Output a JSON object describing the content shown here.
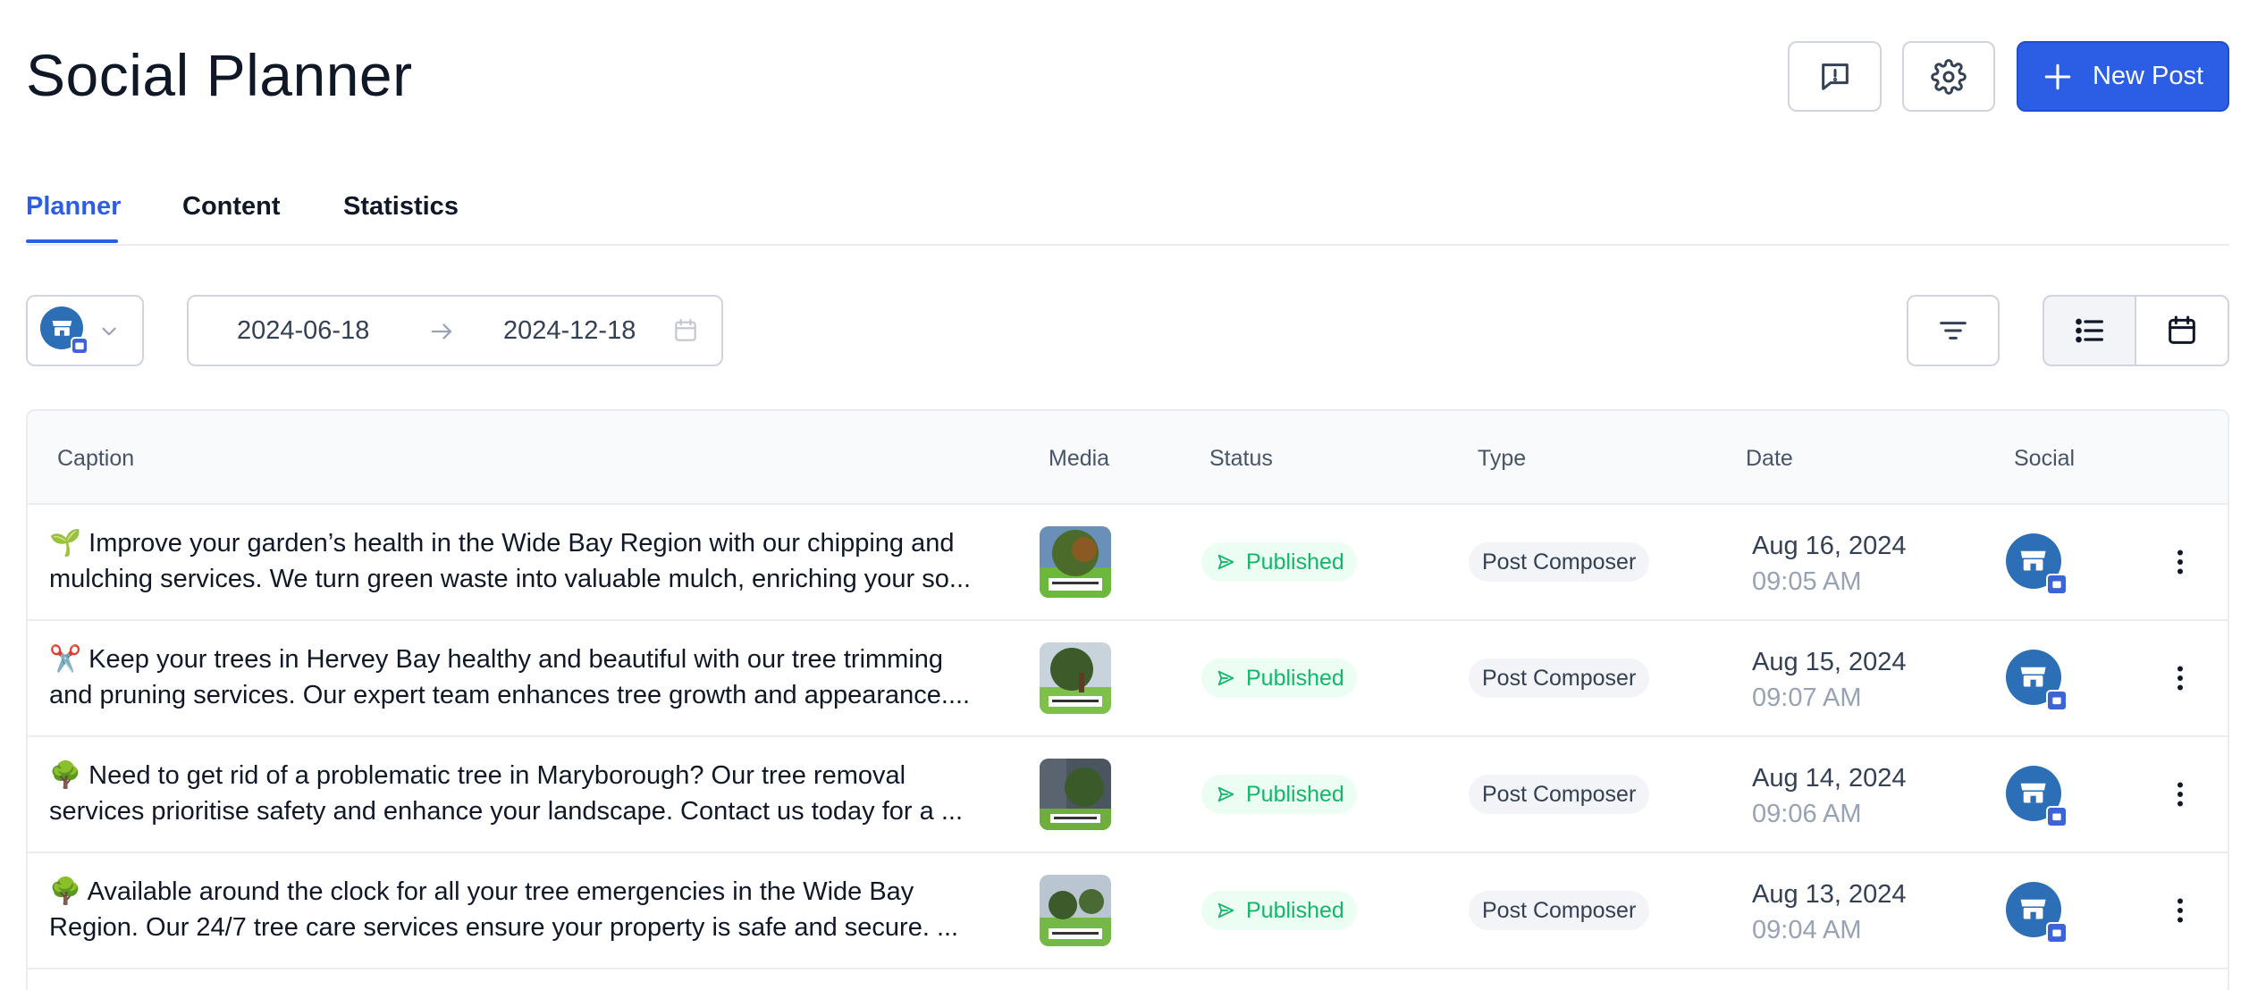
{
  "page": {
    "title": "Social Planner"
  },
  "header": {
    "feedback_icon": "message-alert-icon",
    "settings_icon": "gear-icon",
    "new_post_label": "New Post",
    "new_post_icon": "plus-icon",
    "accent_color": "#2c5ee5"
  },
  "tabs": [
    {
      "label": "Planner",
      "active": true
    },
    {
      "label": "Content",
      "active": false
    },
    {
      "label": "Statistics",
      "active": false
    }
  ],
  "filters": {
    "account_avatar_icon": "store-icon",
    "dropdown_icon": "chevron-down-icon",
    "start_date": "2024-06-18",
    "end_date": "2024-12-18",
    "arrow_icon": "arrow-right-icon",
    "calendar_icon": "calendar-icon",
    "filter_icon": "filter-lines-icon",
    "list_view_icon": "list-icon",
    "calendar_view_icon": "calendar-icon",
    "active_view": "list"
  },
  "table": {
    "columns": [
      "Caption",
      "Media",
      "Status",
      "Type",
      "Date",
      "Social"
    ],
    "rows": [
      {
        "caption_line1": "🌱 Improve your garden’s health in the Wide Bay Region with our chipping and",
        "caption_line2": "mulching services. We turn green waste into valuable mulch, enriching your so...",
        "status": "Published",
        "type": "Post Composer",
        "date": "Aug 16, 2024",
        "time": "09:05 AM"
      },
      {
        "caption_line1": "✂️ Keep your trees in Hervey Bay healthy and beautiful with our tree trimming",
        "caption_line2": "and pruning services. Our expert team enhances tree growth and appearance....",
        "status": "Published",
        "type": "Post Composer",
        "date": "Aug 15, 2024",
        "time": "09:07 AM"
      },
      {
        "caption_line1": "🌳 Need to get rid of a problematic tree in Maryborough? Our tree removal",
        "caption_line2": "services prioritise safety and enhance your landscape. Contact us today for a ...",
        "status": "Published",
        "type": "Post Composer",
        "date": "Aug 14, 2024",
        "time": "09:06 AM"
      },
      {
        "caption_line1": "🌳 Available around the clock for all your tree emergencies in the Wide Bay",
        "caption_line2": "Region. Our 24/7 tree care services ensure your property is safe and secure. ...",
        "status": "Published",
        "type": "Post Composer",
        "date": "Aug 13, 2024",
        "time": "09:04 AM"
      }
    ]
  }
}
